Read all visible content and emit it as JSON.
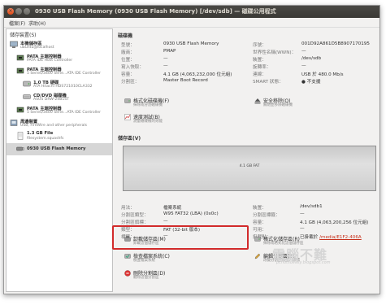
{
  "window": {
    "title": "0930 USB Flash Memory (0930 USB Flash Memory) [/dev/sdb] — 磁碟公用程式",
    "menus": [
      "檔案(F)",
      "求助(H)"
    ]
  },
  "sidebar": {
    "title": "儲存裝置(S)",
    "devices": [
      {
        "name": "本機儲存區",
        "detail": "ubuntu@localhost",
        "level": 0
      },
      {
        "name": "PATA 主端控制器",
        "detail": "PATA IDE Host Controller",
        "level": 1
      },
      {
        "name": "PATA 主端控制器",
        "detail": "5 Series/3400 Serie...ATA IDE Controller",
        "level": 1
      },
      {
        "name": "1.0 TB 硬碟",
        "detail": "ATA Hitachi HDS721010CLA332",
        "level": 2
      },
      {
        "name": "CD/DVD 磁碟機",
        "detail": "ASUS DRW-24B1ST",
        "level": 2
      },
      {
        "name": "PATA 主端控制器",
        "detail": "5 Series/3400 Serie...ATA IDE Controller",
        "level": 1
      },
      {
        "name": "周邊裝置",
        "detail": "USB, FireWire and other peripherals",
        "level": 0
      },
      {
        "name": "1.3 GB File",
        "detail": "filesystem.squashfs",
        "level": 1
      },
      {
        "name": "0930 USB Flash Memory",
        "detail": "",
        "level": 1,
        "selected": true
      }
    ]
  },
  "drive": {
    "section_title": "磁碟機",
    "left": [
      {
        "label": "型號：",
        "value": "0930 USB Flash Memory"
      },
      {
        "label": "廠商：",
        "value": "PMAP"
      },
      {
        "label": "位置：",
        "value": "—"
      },
      {
        "label": "寫入快取：",
        "value": "—"
      },
      {
        "label": "容量：",
        "value": "4.1 GB (4,063,232,000 位元組)"
      },
      {
        "label": "分割區：",
        "value": "Master Boot Record"
      }
    ],
    "right": [
      {
        "label": "序號：",
        "value": "001D92A861D5B8907170195"
      },
      {
        "label": "世界性名稱(WWN)：",
        "value": "—"
      },
      {
        "label": "裝置：",
        "value": "/dev/sdb"
      },
      {
        "label": "旋轉率：",
        "value": "—"
      },
      {
        "label": "連線：",
        "value": "USB 於 480.0 Mb/s"
      },
      {
        "label": "SMART 狀態：",
        "value": "不支援"
      }
    ],
    "actions": [
      {
        "title": "格式化磁碟機(F)",
        "desc": "抹除或分割磁碟機"
      },
      {
        "title": "安全移除(O)",
        "desc": "關閉並移除磁碟機"
      },
      {
        "title": "速度測試(B)",
        "desc": "測量磁碟機的效能"
      }
    ]
  },
  "volumes": {
    "section_title": "儲存區(V)",
    "partition_label": "4.1 GB FAT",
    "left": [
      {
        "label": "用法：",
        "value": "檔案系統"
      },
      {
        "label": "分割區類型：",
        "value": "W95 FAT32 (LBA) (0x0c)"
      },
      {
        "label": "分割區旗標：",
        "value": "—"
      },
      {
        "label": "類型：",
        "value": "FAT (32-bit 版本)"
      },
      {
        "label": "標籤：",
        "value": "—"
      }
    ],
    "right": [
      {
        "label": "裝置：",
        "value": "/dev/sdb1"
      },
      {
        "label": "分割區標籤：",
        "value": "—"
      },
      {
        "label": "容量：",
        "value": "4.1 GB (4,063,200,256 位元組)"
      },
      {
        "label": "可用：",
        "value": "—"
      },
      {
        "label": "掛載點：",
        "value": "已掛載於 ",
        "link": "/media/E1F2-406A"
      }
    ],
    "actions": [
      {
        "title": "卸載儲存區(M)",
        "desc": "卸載這個儲存區"
      },
      {
        "title": "格式化儲存區(R)",
        "desc": "抹除或格式化這個儲存區"
      },
      {
        "title": "檢查檔案系統(C)",
        "desc": "檢查檔案系統"
      },
      {
        "title": "編輯分割區(E)",
        "desc": "改變分割區類型、旗標"
      },
      {
        "title": "刪除分割區(D)",
        "desc": "刪除這個分割區"
      }
    ]
  },
  "watermark": {
    "line1": "電腦不難",
    "line2": "pcnotsoeasy.blogspot.com"
  },
  "colors": {
    "highlight": "#d22b2b",
    "titlebar": "#3c3b37",
    "link": "#c7311d"
  }
}
